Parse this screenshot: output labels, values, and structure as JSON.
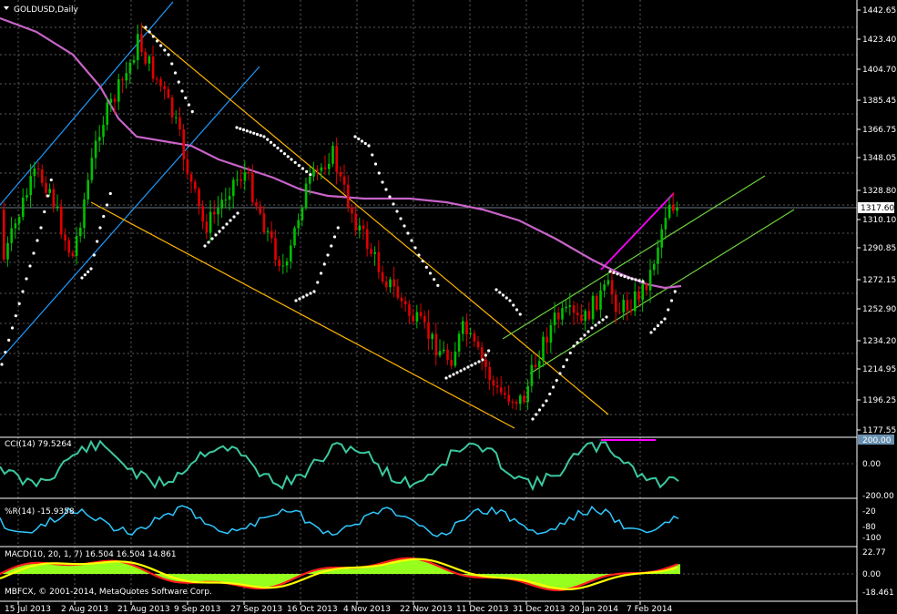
{
  "chart_title": "GOLDUSD,Daily",
  "current_price": "1317.60",
  "price_axis": [
    "1442.65",
    "1423.40",
    "1404.70",
    "1385.45",
    "1366.75",
    "1348.05",
    "1328.80",
    "1310.10",
    "1290.85",
    "1272.15",
    "1252.90",
    "1234.20",
    "1214.95",
    "1196.25",
    "1177.55"
  ],
  "date_axis": [
    "15 Jul 2013",
    "2 Aug 2013",
    "21 Aug 2013",
    "9 Sep 2013",
    "27 Sep 2013",
    "16 Oct 2013",
    "4 Nov 2013",
    "22 Nov 2013",
    "11 Dec 2013",
    "31 Dec 2013",
    "20 Jan 2014",
    "7 Feb 2014"
  ],
  "cci": {
    "label": "CCI(14) 79.5264",
    "levels": [
      "200.00",
      "0.00",
      "-200.00"
    ]
  },
  "wpr": {
    "label": "%R(14) -15.9358",
    "levels": [
      "-20",
      "-80",
      "-100"
    ]
  },
  "macd": {
    "label": "MACD(10, 20, 1, 7) 16.504 16.504 14.861",
    "levels": [
      "22.77",
      "0.00",
      "-18.461"
    ]
  },
  "copyright": "MBFCX, © 2001-2014, MetaQuotes Software Corp.",
  "colors": {
    "bull": "#00c000",
    "bear": "#e00000",
    "ma": "#c864c8",
    "channel_orange": "#ffb400",
    "channel_blue": "#1e9bff",
    "channel_green": "#6ed23c",
    "trend_magenta": "#ff00ff",
    "cci": "#3cc8a0",
    "wpr": "#2ec8ff",
    "macd_hist": "#96ff1e",
    "macd_red": "#ff1e1e",
    "macd_yellow": "#ffff00"
  }
}
